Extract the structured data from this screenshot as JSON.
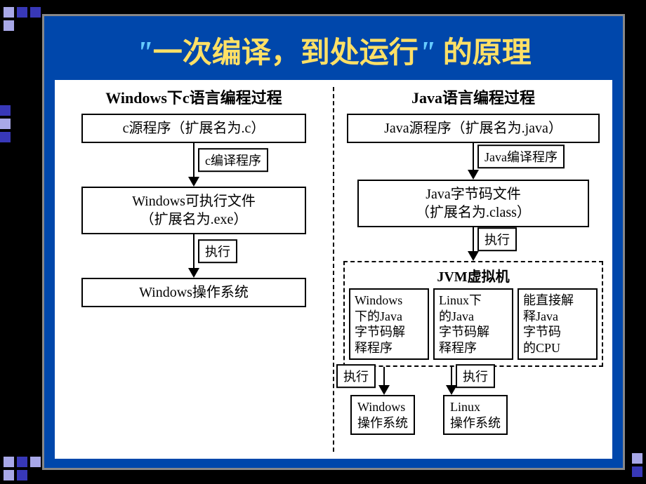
{
  "title": {
    "quote_open": "\"",
    "main": "一次编译，到处运行",
    "quote_close": "\"",
    "suffix": " 的原理"
  },
  "left": {
    "heading": "Windows下c语言编程过程",
    "source": "c源程序（扩展名为.c）",
    "compile_label": "c编译程序",
    "exe": "Windows可执行文件\n（扩展名为.exe）",
    "exec_label": "执行",
    "os": "Windows操作系统"
  },
  "right": {
    "heading": "Java语言编程过程",
    "source": "Java源程序（扩展名为.java）",
    "compile_label": "Java编译程序",
    "bytecode": "Java字节码文件\n（扩展名为.class）",
    "exec_label": "执行",
    "jvm_title": "JVM虚拟机",
    "jvm_boxes": [
      "Windows\n下的Java\n字节码解\n释程序",
      "Linux下\n的Java\n字节码解\n释程序",
      "能直接解\n释Java\n字节码\n的CPU"
    ],
    "os_exec_label": "执行",
    "os_boxes": [
      "Windows\n操作系统",
      "Linux\n操作系统"
    ]
  }
}
